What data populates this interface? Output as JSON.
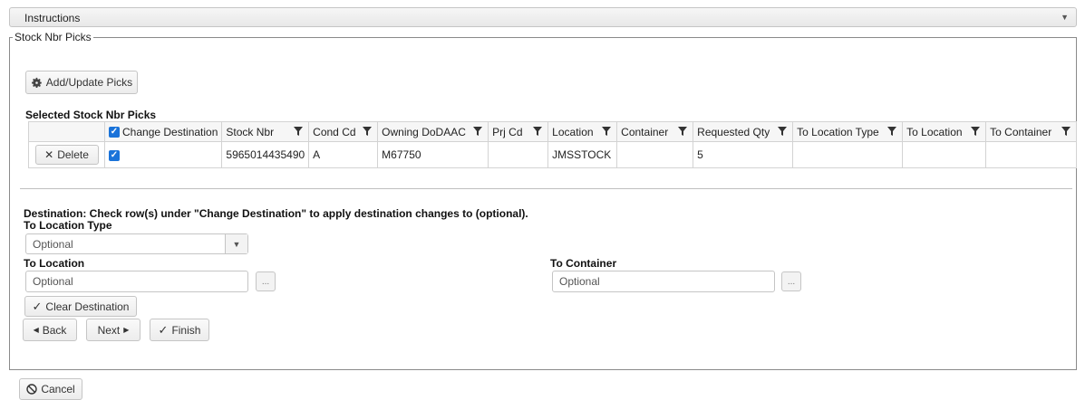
{
  "instructions": {
    "title": "Instructions"
  },
  "stock_picks": {
    "legend": "Stock Nbr Picks",
    "add_update_label": "Add/Update Picks",
    "selected_label": "Selected Stock Nbr Picks",
    "table": {
      "headers": [
        "Change Destination",
        "Stock Nbr",
        "Cond Cd",
        "Owning DoDAAC",
        "Prj Cd",
        "Location",
        "Container",
        "Requested Qty",
        "To Location Type",
        "To Location",
        "To Container"
      ],
      "rows": [
        {
          "action": "Delete",
          "change_destination_checked": true,
          "stock_nbr": "5965014435490",
          "cond_cd": "A",
          "owning_dodaac": "M67750",
          "prj_cd": "",
          "location": "JMSSTOCK",
          "container": "",
          "requested_qty": "5",
          "to_location_type": "",
          "to_location": "",
          "to_container": ""
        }
      ]
    }
  },
  "destination": {
    "note": "Destination: Check row(s) under \"Change Destination\" to apply destination changes to (optional).",
    "to_location_type_label": "To Location Type",
    "to_location_type_value": "Optional",
    "to_location_label": "To Location",
    "to_location_placeholder": "Optional",
    "to_container_label": "To Container",
    "to_container_placeholder": "Optional",
    "ellipsis": "...",
    "clear_label": "Clear Destination"
  },
  "nav": {
    "back": "Back",
    "next": "Next",
    "finish": "Finish"
  },
  "footer": {
    "cancel": "Cancel"
  }
}
